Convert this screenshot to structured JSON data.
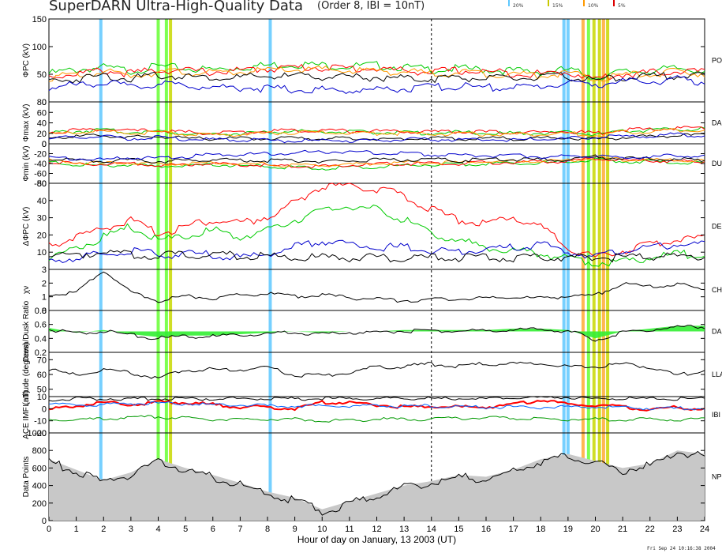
{
  "header": {
    "title": "SuperDARN Ultra-High-Quality Data",
    "order_label": "(Order 8, IBI = 10nT)",
    "legend_pcts": [
      "20%",
      "15%",
      "10%",
      "5%"
    ],
    "legend_colors": [
      "#5ec8ff",
      "#c8c800",
      "#ff9900",
      "#dd0000"
    ]
  },
  "footer": {
    "timestamp": "Fri Sep 24 10:16:38 2004"
  },
  "chart_data": {
    "type": "line",
    "xlabel": "Hour of day on January, 13 2003 (UT)",
    "xlim": [
      0,
      24
    ],
    "xticks": [
      "0",
      "1",
      "2",
      "3",
      "4",
      "5",
      "6",
      "7",
      "8",
      "9",
      "10",
      "11",
      "12",
      "13",
      "14",
      "15",
      "16",
      "17",
      "18",
      "19",
      "20",
      "21",
      "22",
      "23",
      "24"
    ],
    "dashed_hour": 14,
    "vertical_bands": [
      {
        "hours": [
          1.9,
          8.1,
          18.85,
          19.0
        ],
        "color": "#5ec8ff",
        "label": "20%"
      },
      {
        "hours": [
          4.0,
          4.3,
          19.75
        ],
        "color": "#66ff33",
        "label": "20%"
      },
      {
        "hours": [
          4.45,
          19.95,
          20.15,
          20.45
        ],
        "color": "#c8d800",
        "label": "15%"
      },
      {
        "hours": [
          19.55,
          20.3
        ],
        "color": "#ffaa33",
        "label": "10%"
      }
    ],
    "panels": [
      {
        "id": "pcp",
        "ylabel": "ΦPC (kV)",
        "ylim": [
          0,
          150
        ],
        "yticks": [
          0,
          50,
          100,
          150
        ],
        "right_label": "PO",
        "series": [
          {
            "color": "#00cc00",
            "values": [
              55,
              62,
              66,
              60,
              68,
              64,
              62,
              66,
              70,
              72,
              70,
              68,
              70,
              66,
              62,
              64,
              62,
              60,
              58,
              62,
              48,
              58,
              60,
              64,
              62
            ]
          },
          {
            "color": "#ff0000",
            "values": [
              50,
              55,
              60,
              55,
              62,
              60,
              58,
              60,
              64,
              66,
              66,
              64,
              64,
              60,
              58,
              60,
              58,
              56,
              54,
              58,
              45,
              54,
              56,
              60,
              58
            ]
          },
          {
            "color": "#ff9900",
            "values": [
              48,
              52,
              58,
              52,
              58,
              58,
              55,
              58,
              60,
              62,
              62,
              60,
              60,
              58,
              55,
              58,
              55,
              54,
              52,
              56,
              44,
              52,
              54,
              58,
              56
            ]
          },
          {
            "color": "#000000",
            "values": [
              42,
              45,
              52,
              46,
              52,
              50,
              48,
              48,
              50,
              50,
              50,
              48,
              48,
              46,
              46,
              48,
              46,
              46,
              48,
              50,
              42,
              48,
              50,
              52,
              50
            ]
          },
          {
            "color": "#0000cc",
            "values": [
              30,
              34,
              40,
              30,
              36,
              34,
              30,
              30,
              28,
              26,
              26,
              24,
              26,
              28,
              30,
              32,
              30,
              30,
              32,
              38,
              36,
              40,
              40,
              44,
              40
            ]
          }
        ]
      },
      {
        "id": "pmax",
        "ylabel": "Φmax (kV)",
        "ylim": [
          0,
          80
        ],
        "yticks": [
          0,
          20,
          40,
          60,
          80
        ],
        "right_label": "DA",
        "series": [
          {
            "color": "#00cc00",
            "values": [
              22,
              26,
              28,
              24,
              26,
              22,
              20,
              22,
              24,
              26,
              26,
              24,
              24,
              24,
              22,
              24,
              22,
              22,
              22,
              24,
              20,
              26,
              28,
              30,
              30
            ]
          },
          {
            "color": "#ff0000",
            "values": [
              24,
              28,
              30,
              26,
              28,
              24,
              22,
              24,
              26,
              28,
              28,
              26,
              26,
              26,
              24,
              26,
              24,
              24,
              24,
              26,
              22,
              28,
              30,
              32,
              32
            ]
          },
          {
            "color": "#ff9900",
            "values": [
              20,
              24,
              26,
              22,
              24,
              20,
              18,
              20,
              22,
              24,
              24,
              22,
              22,
              22,
              20,
              22,
              20,
              20,
              20,
              22,
              18,
              24,
              26,
              28,
              28
            ]
          },
          {
            "color": "#000000",
            "values": [
              14,
              16,
              18,
              14,
              16,
              12,
              12,
              12,
              12,
              12,
              12,
              12,
              12,
              12,
              12,
              12,
              12,
              12,
              12,
              14,
              10,
              14,
              16,
              18,
              18
            ]
          },
          {
            "color": "#0000cc",
            "values": [
              12,
              14,
              16,
              12,
              14,
              10,
              10,
              10,
              8,
              8,
              8,
              8,
              8,
              10,
              10,
              10,
              10,
              10,
              10,
              12,
              14,
              16,
              16,
              20,
              18
            ]
          }
        ]
      },
      {
        "id": "pmin",
        "ylabel": "Φmin (kV)",
        "ylim": [
          -80,
          0
        ],
        "yticks": [
          0,
          -20,
          -40,
          -60,
          -80
        ],
        "right_label": "DU",
        "series": [
          {
            "color": "#00cc00",
            "values": [
              -36,
              -40,
              -42,
              -40,
              -44,
              -42,
              -40,
              -42,
              -44,
              -46,
              -48,
              -46,
              -44,
              -42,
              -40,
              -40,
              -38,
              -38,
              -36,
              -36,
              -30,
              -34,
              -34,
              -36,
              -36
            ]
          },
          {
            "color": "#ff0000",
            "values": [
              -34,
              -38,
              -40,
              -38,
              -42,
              -40,
              -38,
              -40,
              -42,
              -44,
              -44,
              -42,
              -40,
              -38,
              -38,
              -38,
              -36,
              -36,
              -34,
              -34,
              -28,
              -32,
              -32,
              -34,
              -34
            ]
          },
          {
            "color": "#ff9900",
            "values": [
              -32,
              -36,
              -38,
              -36,
              -40,
              -38,
              -36,
              -38,
              -40,
              -42,
              -42,
              -40,
              -38,
              -36,
              -36,
              -36,
              -34,
              -34,
              -32,
              -32,
              -26,
              -30,
              -30,
              -32,
              -32
            ]
          },
          {
            "color": "#000000",
            "values": [
              -30,
              -32,
              -34,
              -30,
              -34,
              -32,
              -30,
              -32,
              -32,
              -32,
              -34,
              -32,
              -30,
              -30,
              -30,
              -32,
              -30,
              -30,
              -30,
              -30,
              -24,
              -28,
              -28,
              -30,
              -30
            ]
          },
          {
            "color": "#0000cc",
            "values": [
              -26,
              -28,
              -30,
              -26,
              -28,
              -24,
              -20,
              -20,
              -18,
              -16,
              -14,
              -14,
              -16,
              -18,
              -20,
              -22,
              -22,
              -22,
              -24,
              -24,
              -22,
              -26,
              -24,
              -22,
              -22
            ]
          }
        ]
      },
      {
        "id": "dpcp",
        "ylabel": "ΔΦPC (kV)",
        "ylim": [
          0,
          50
        ],
        "yticks": [
          10,
          20,
          30,
          40,
          50
        ],
        "right_label": "DE",
        "series": [
          {
            "color": "#ff0000",
            "values": [
              15,
              20,
              25,
              30,
              22,
              26,
              30,
              28,
              32,
              40,
              50,
              50,
              48,
              44,
              36,
              30,
              28,
              32,
              26,
              14,
              8,
              12,
              16,
              18,
              20
            ]
          },
          {
            "color": "#00cc00",
            "values": [
              8,
              14,
              20,
              26,
              18,
              20,
              24,
              20,
              24,
              30,
              36,
              38,
              36,
              30,
              22,
              18,
              14,
              12,
              10,
              8,
              5,
              6,
              8,
              10,
              10
            ]
          },
          {
            "color": "#0000cc",
            "values": [
              6,
              8,
              10,
              12,
              10,
              10,
              10,
              8,
              10,
              14,
              18,
              16,
              14,
              14,
              12,
              12,
              12,
              14,
              16,
              12,
              8,
              12,
              14,
              16,
              16
            ]
          },
          {
            "color": "#000000",
            "values": [
              10,
              10,
              11,
              10,
              9,
              10,
              10,
              9,
              9,
              8,
              8,
              8,
              8,
              8,
              8,
              8,
              8,
              8,
              8,
              8,
              8,
              8,
              9,
              9,
              9
            ]
          }
        ]
      },
      {
        "id": "chi",
        "ylabel": "χν",
        "ylim": [
          0,
          3
        ],
        "yticks": [
          0,
          1,
          2,
          3
        ],
        "right_label": "CH",
        "series": [
          {
            "color": "#000000",
            "values": [
              1.2,
              1.4,
              3.0,
              1.4,
              0.8,
              1.1,
              1.0,
              1.2,
              1.3,
              1.1,
              1.2,
              1.0,
              0.9,
              0.8,
              0.9,
              0.9,
              1.0,
              1.0,
              1.0,
              1.1,
              1.2,
              2.0,
              1.8,
              2.0,
              1.6
            ]
          }
        ]
      },
      {
        "id": "ratio",
        "ylabel": "Dawn/Dusk Ratio",
        "ylim": [
          0.2,
          0.8
        ],
        "yticks": [
          0.2,
          0.4,
          0.6,
          0.8
        ],
        "right_label": "DA",
        "series": [
          {
            "color": "#000000",
            "values": [
              0.55,
              0.48,
              0.52,
              0.46,
              0.42,
              0.44,
              0.44,
              0.46,
              0.48,
              0.5,
              0.48,
              0.5,
              0.5,
              0.52,
              0.52,
              0.52,
              0.52,
              0.54,
              0.54,
              0.52,
              0.4,
              0.5,
              0.54,
              0.58,
              0.58
            ]
          }
        ]
      },
      {
        "id": "lat",
        "ylabel": "Latitude (degrees)",
        "ylim": [
          45,
          75
        ],
        "yticks": [
          50,
          60,
          70
        ],
        "right_label": "LLA",
        "series": [
          {
            "color": "#000000",
            "values": [
              64,
              60,
              64,
              62,
              58,
              64,
              64,
              64,
              66,
              60,
              60,
              62,
              66,
              66,
              68,
              66,
              68,
              68,
              68,
              66,
              66,
              68,
              66,
              60,
              64
            ]
          }
        ]
      },
      {
        "id": "imf",
        "ylabel": "ACE IMF (nT)",
        "ylim": [
          -20,
          10
        ],
        "yticks": [
          -20,
          -10,
          0,
          10
        ],
        "right_label": "IBI",
        "series": [
          {
            "color": "#ff0000",
            "values": [
              0,
              3,
              6,
              4,
              6,
              6,
              4,
              2,
              2,
              1,
              6,
              6,
              4,
              2,
              3,
              2,
              2,
              4,
              8,
              4,
              4,
              2,
              0,
              2,
              0
            ]
          },
          {
            "color": "#000000",
            "values": [
              8,
              9,
              9,
              9,
              9,
              9,
              9,
              9,
              9,
              9,
              9,
              9,
              9,
              9,
              9,
              9,
              9,
              10,
              10,
              10,
              9,
              9,
              9,
              9,
              9
            ]
          },
          {
            "color": "#0066ff",
            "values": [
              4,
              4,
              4,
              5,
              5,
              5,
              4,
              4,
              3,
              3,
              3,
              3,
              3,
              3,
              3,
              2,
              2,
              2,
              2,
              2,
              2,
              2,
              1,
              1,
              1
            ]
          },
          {
            "color": "#009900",
            "values": [
              -8,
              -8,
              -8,
              -6,
              -6,
              -7,
              -8,
              -8,
              -8,
              -8,
              -9,
              -9,
              -8,
              -8,
              -8,
              -7,
              -7,
              -7,
              -8,
              -8,
              -8,
              -8,
              -8,
              -8,
              -8
            ]
          }
        ]
      },
      {
        "id": "npnt",
        "ylabel": "Data Points",
        "ylim": [
          0,
          1000
        ],
        "yticks": [
          0,
          200,
          400,
          600,
          800,
          1000
        ],
        "right_label": "NP",
        "series": [
          {
            "color": "#000000",
            "values": [
              700,
              580,
              460,
              550,
              700,
              600,
              520,
              430,
              330,
              260,
              130,
              220,
              310,
              400,
              450,
              520,
              500,
              580,
              700,
              760,
              680,
              600,
              650,
              800,
              760
            ]
          }
        ]
      }
    ]
  }
}
